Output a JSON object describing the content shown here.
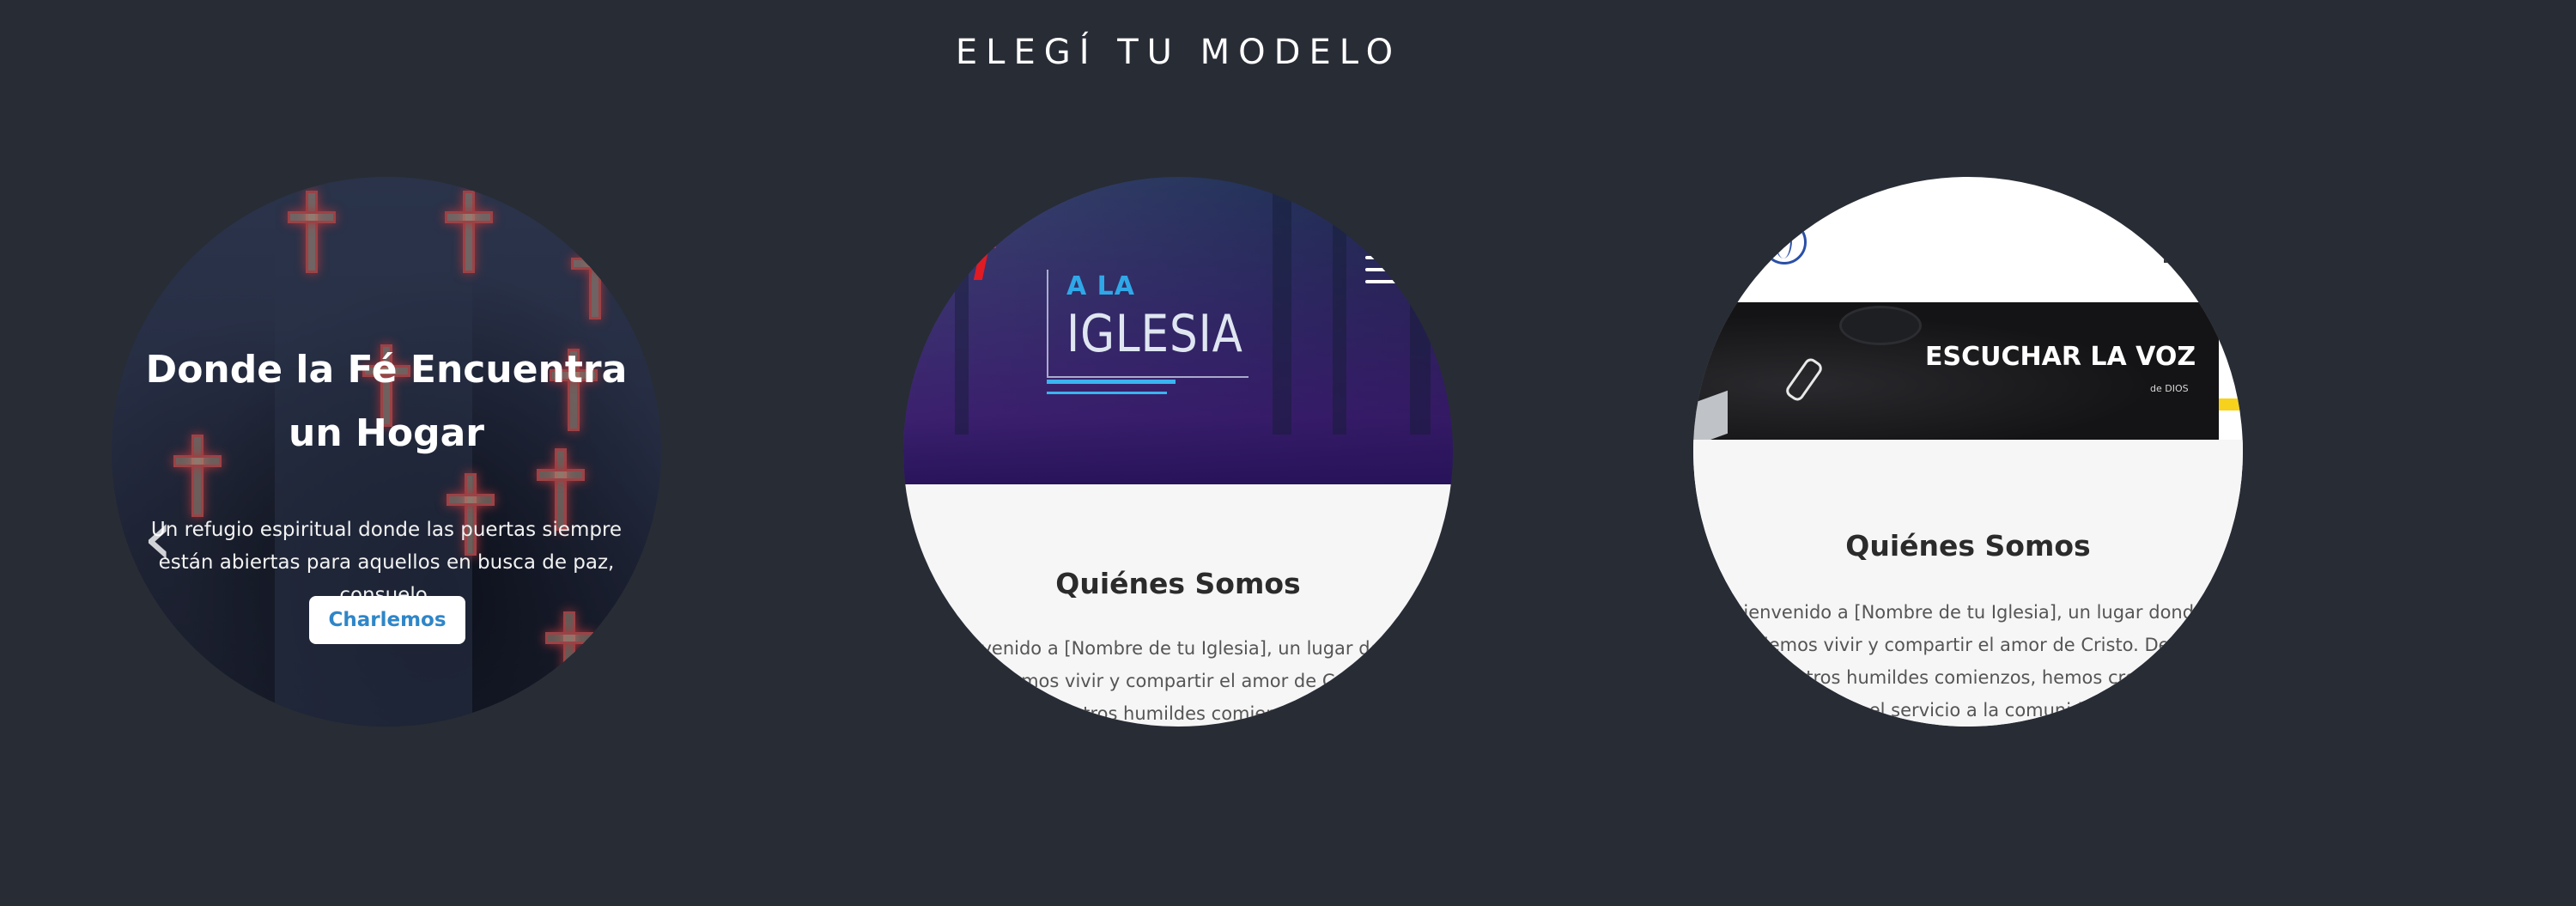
{
  "section_title": "ELEGÍ TU MODELO",
  "models": [
    {
      "heading": "Donde la Fé Encuentra un Hogar",
      "text": "Un refugio espiritual donde las puertas siempre están abiertas para aquellos en busca de paz, consuelo.",
      "button": "Charlemos",
      "prev_icon": "chevron-left-icon"
    },
    {
      "logo_small": "A LA",
      "logo_big": "IGLESIA",
      "menu_icon": "hamburger-icon",
      "heading": "Quiénes Somos",
      "paragraph_lines": [
        "Bienvenido a [Nombre de tu Iglesia], un lugar donde",
        "podemos vivir y compartir el amor de Cristo.",
        "Desde nuestros humildes comienzos, hemos"
      ]
    },
    {
      "banner_title": "ESCUCHAR LA VOZ",
      "banner_sub": "de DIOS",
      "logo_icon": "globe-icon",
      "heading": "Quiénes Somos",
      "paragraph_lines": [
        "Bienvenido a [Nombre de tu Iglesia], un lugar donde",
        "podemos vivir y compartir el amor de Cristo. Desde",
        "nuestros humildes comienzos, hemos crecido",
        "con el servicio a la comunidad"
      ]
    }
  ],
  "colors": {
    "page_background": "#282c35",
    "button_text": "#2e86c8",
    "accent_red": "#e01b24",
    "accent_blue": "#3bb4f0",
    "accent_yellow": "#f6d21c"
  }
}
